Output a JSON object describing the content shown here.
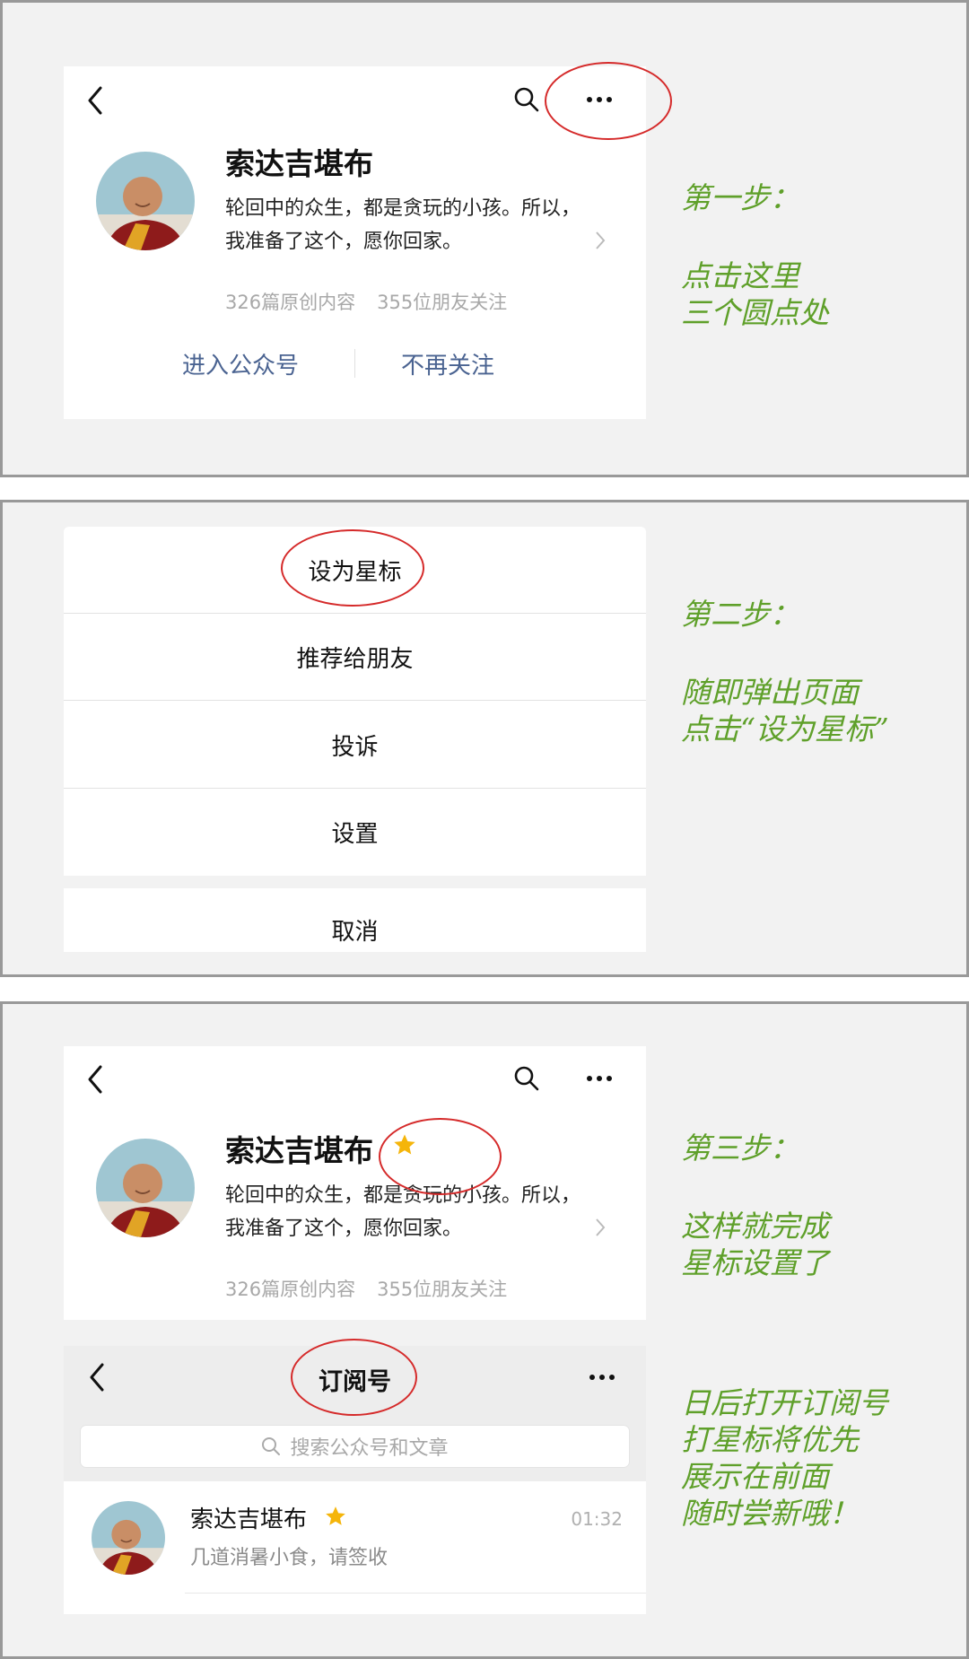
{
  "account": {
    "name": "索达吉堪布",
    "description": "轮回中的众生，都是贪玩的小孩。所以，我准备了这个，愿你回家。",
    "original_count": "326篇原创内容",
    "followers": "355位朋友关注",
    "enter_label": "进入公众号",
    "unfollow_label": "不再关注"
  },
  "menu": {
    "items": [
      "设为星标",
      "推荐给朋友",
      "投诉",
      "设置"
    ],
    "cancel": "取消"
  },
  "subscription": {
    "title": "订阅号",
    "search_placeholder": "搜索公众号和文章",
    "item": {
      "name": "索达吉堪布",
      "preview": "几道消暑小食，请签收",
      "time": "01:32"
    }
  },
  "notes": {
    "step1": {
      "title": "第一步：",
      "lines": [
        "点击这里",
        "三个圆点处"
      ]
    },
    "step2": {
      "title": "第二步：",
      "lines": [
        "随即弹出页面",
        "点击“设为星标”"
      ]
    },
    "step3": {
      "title": "第三步：",
      "lines": [
        "这样就完成",
        "星标设置了"
      ]
    },
    "step3_extra": {
      "lines": [
        "日后打开订阅号",
        "打星标将优先",
        "展示在前面",
        "随时尝新哦！"
      ]
    }
  },
  "colors": {
    "annotation_green": "#5fa02a",
    "circle_red": "#d52a2a",
    "link_blue": "#4a6391",
    "star_gold": "#f5b50a"
  },
  "icons": [
    "back-icon",
    "search-icon",
    "more-icon",
    "chevron-right-icon",
    "star-icon"
  ]
}
